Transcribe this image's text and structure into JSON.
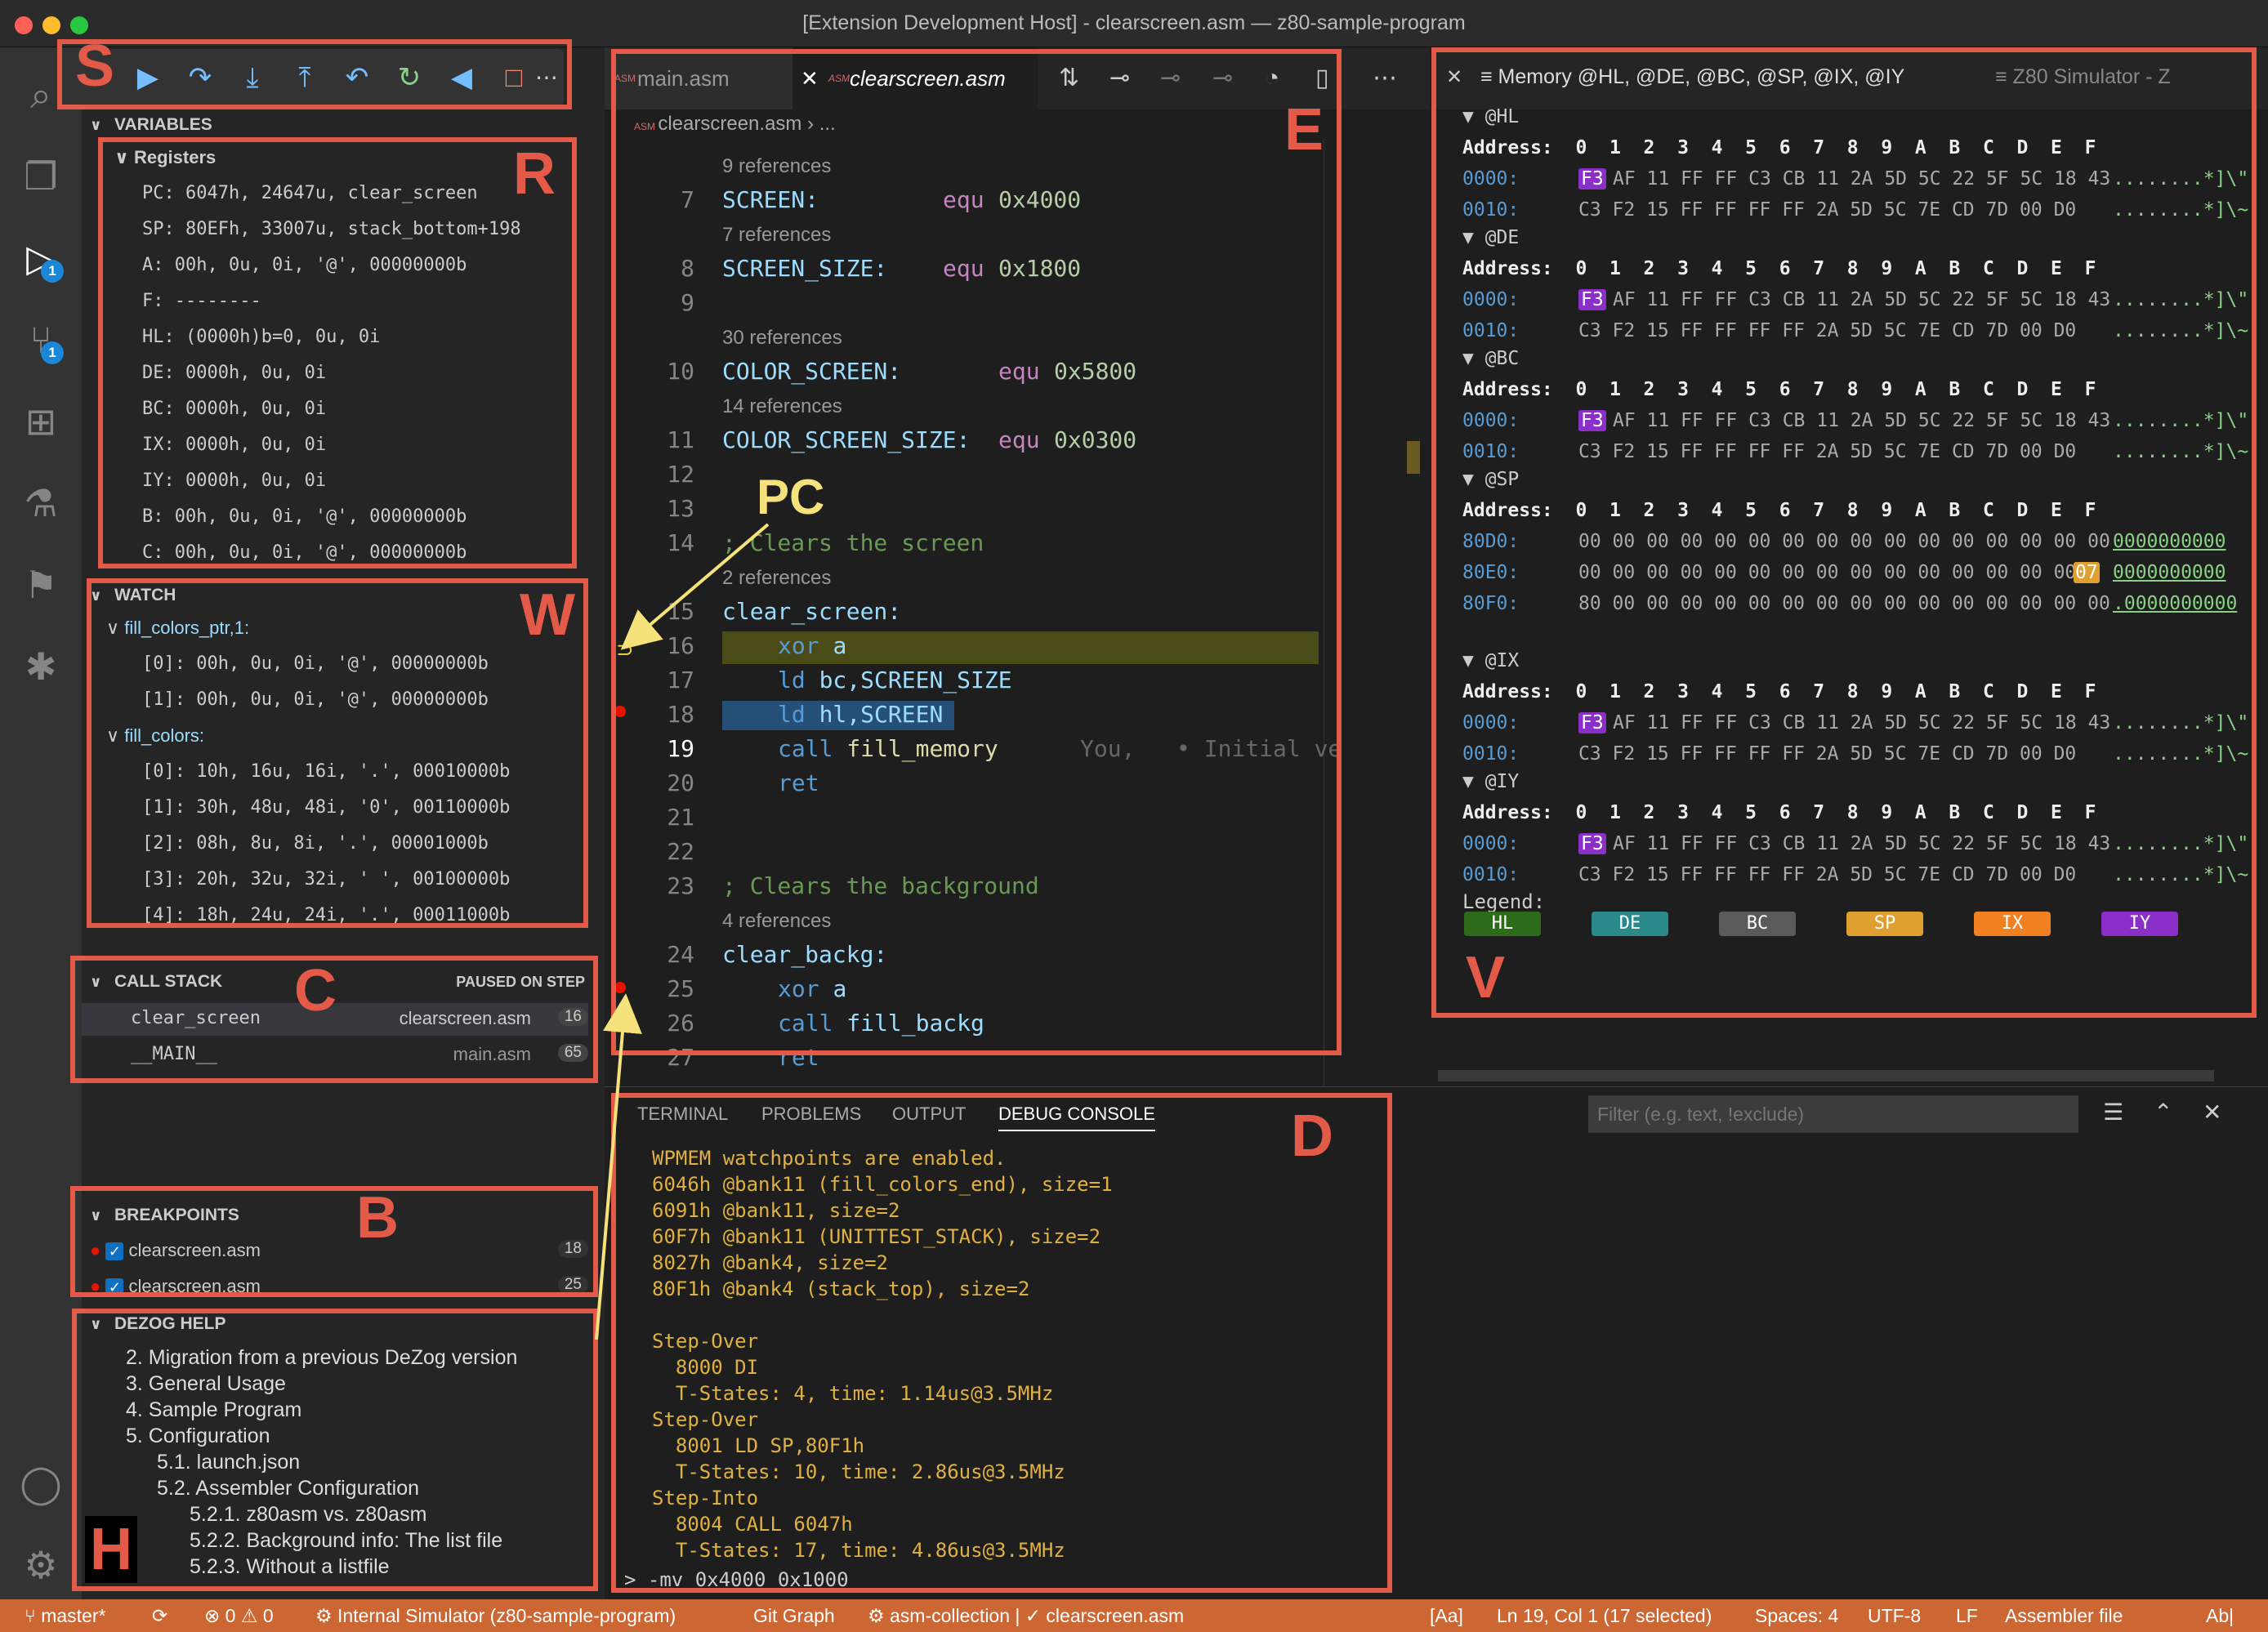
{
  "window": {
    "title": "[Extension Development Host] - clearscreen.asm — z80-sample-program"
  },
  "activity": {
    "debug_badge": "1",
    "scm_badge": "1"
  },
  "variables": {
    "header": "VARIABLES",
    "registers_label": "Registers",
    "rows": [
      "PC: 6047h, 24647u, clear_screen",
      "SP: 80EFh, 33007u, stack_bottom+198",
      "A: 00h, 0u, 0i, '@', 00000000b",
      "F: --------",
      "HL: (0000h)b=0, 0u, 0i",
      "DE: 0000h, 0u, 0i",
      "BC: 0000h, 0u, 0i",
      "IX: 0000h, 0u, 0i",
      "IY: 0000h, 0u, 0i",
      "B: 00h, 0u, 0i, '@', 00000000b",
      "C: 00h, 0u, 0i, '@', 00000000b"
    ]
  },
  "watch": {
    "header": "WATCH",
    "group1": "fill_colors_ptr,1:",
    "group1_rows": [
      "[0]: 00h,   0u,    0i, '@', 00000000b",
      "[1]: 00h,   0u,    0i, '@', 00000000b"
    ],
    "group2": "fill_colors:",
    "group2_rows": [
      "[0]: 10h,  16u,   16i, '.', 00010000b",
      "[1]: 30h,  48u,   48i, '0', 00110000b",
      "[2]: 08h,   8u,    8i, '.', 00001000b",
      "[3]: 20h,  32u,   32i, ' ', 00100000b",
      "[4]: 18h,  24u,   24i, '.', 00011000b"
    ]
  },
  "callstack": {
    "header": "CALL STACK",
    "status": "PAUSED ON STEP",
    "frames": [
      {
        "name": "clear_screen",
        "file": "clearscreen.asm",
        "line": "16"
      },
      {
        "name": "__MAIN__",
        "file": "main.asm",
        "line": "65"
      }
    ]
  },
  "breakpoints": {
    "header": "BREAKPOINTS",
    "items": [
      {
        "file": "clearscreen.asm",
        "line": "18"
      },
      {
        "file": "clearscreen.asm",
        "line": "25"
      }
    ]
  },
  "dezog_help": {
    "header": "DEZOG HELP",
    "items": [
      "2. Migration from a previous DeZog version",
      "3. General Usage",
      "4. Sample Program",
      "5. Configuration",
      "5.1. launch.json",
      "5.2. Assembler Configuration",
      "5.2.1. z80asm vs. z80asm",
      "5.2.2. Background info: The list file",
      "5.2.3. Without a listfile"
    ]
  },
  "editor": {
    "tabs": [
      {
        "label": "main.asm"
      },
      {
        "label": "clearscreen.asm"
      }
    ],
    "breadcrumb": "clearscreen.asm",
    "breadcrumb_more": "...",
    "refs": {
      "r7": "9 references",
      "r8": "7 references",
      "r10": "30 references",
      "r11": "14 references",
      "r15": "2 references",
      "r24": "4 references"
    },
    "gutter": [
      "7",
      "8",
      "9",
      "10",
      "11",
      "12",
      "13",
      "14",
      "15",
      "16",
      "17",
      "18",
      "19",
      "20",
      "21",
      "22",
      "23",
      "24",
      "25",
      "26",
      "27"
    ],
    "code": {
      "l7a": "SCREEN:",
      "l7b": "equ",
      "l7c": "0x4000",
      "l8a": "SCREEN_SIZE:",
      "l8b": "equ",
      "l8c": "0x1800",
      "l10a": "COLOR_SCREEN:",
      "l10b": "equ",
      "l10c": "0x5800",
      "l11a": "COLOR_SCREEN_SIZE:",
      "l11b": "equ",
      "l11c": "0x0300",
      "l14": "; Clears the screen",
      "l15": "clear_screen:",
      "l16a": "xor",
      "l16b": "a",
      "l17a": "ld",
      "l17b": "bc,SCREEN_SIZE",
      "l18a": "ld",
      "l18b": "hl,SCREEN",
      "l19a": "call",
      "l19b": "fill_memory",
      "l19blame": "You,   • Initial ve",
      "l20": "ret",
      "l23": "; Clears the background",
      "l24": "clear_backg:",
      "l25a": "xor",
      "l25b": "a",
      "l26a": "call",
      "l26b": "fill_backg",
      "l27": "ret"
    }
  },
  "memory": {
    "tab1": "Memory @HL, @DE, @BC, @SP, @IX, @IY",
    "tab2": "Z80 Simulator - Z",
    "header_row": "Address:  0  1  2  3  4  5  6  7  8  9  A  B  C  D  E  F",
    "groups": [
      {
        "name": "@HL",
        "r1": "AF 11 FF FF C3 CB 11 2A 5D 5C 22 5F 5C 18 43",
        "r1ascii": "........*]\\\"",
        "r2": "C3 F2 15 FF FF FF FF 2A 5D 5C 7E CD 7D 00 D0",
        "r2ascii": "........*]\\~"
      },
      {
        "name": "@DE",
        "r1": "AF 11 FF FF C3 CB 11 2A 5D 5C 22 5F 5C 18 43",
        "r1ascii": "........*]\\\"",
        "r2": "C3 F2 15 FF FF FF FF 2A 5D 5C 7E CD 7D 00 D0",
        "r2ascii": "........*]\\~"
      },
      {
        "name": "@BC",
        "r1": "AF 11 FF FF C3 CB 11 2A 5D 5C 22 5F 5C 18 43",
        "r1ascii": "........*]\\\"",
        "r2": "C3 F2 15 FF FF FF FF 2A 5D 5C 7E CD 7D 00 D0",
        "r2ascii": "........*]\\~"
      },
      {
        "name": "@IX",
        "r1": "AF 11 FF FF C3 CB 11 2A 5D 5C 22 5F 5C 18 43",
        "r1ascii": "........*]\\\"",
        "r2": "C3 F2 15 FF FF FF FF 2A 5D 5C 7E CD 7D 00 D0",
        "r2ascii": "........*]\\~"
      },
      {
        "name": "@IY",
        "r1": "AF 11 FF FF C3 CB 11 2A 5D 5C 22 5F 5C 18 43",
        "r1ascii": "........*]\\\"",
        "r2": "C3 F2 15 FF FF FF FF 2A 5D 5C 7E CD 7D 00 D0",
        "r2ascii": "........*]\\~"
      }
    ],
    "addr0": "0000:",
    "addr1": "0010:",
    "first_byte": "F3",
    "sp": {
      "name": "@SP",
      "a1": "80D0:",
      "d1": "00 00 00 00 00 00 00 00 00 00 00 00 00 00 00 00",
      "t1": "0000000000",
      "a2": "80E0:",
      "d2": "00 00 00 00 00 00 00 00 00 00 00 00 00 00 00",
      "hl2": "07",
      "t2": "0000000000",
      "a3": "80F0:",
      "d3": "80 00 00 00 00 00 00 00 00 00 00 00 00 00 00 00",
      "t3": ".0000000000"
    },
    "legend_label": "Legend:",
    "legend": [
      "HL",
      "DE",
      "BC",
      "SP",
      "IX",
      "IY"
    ]
  },
  "panel": {
    "tabs": [
      "TERMINAL",
      "PROBLEMS",
      "OUTPUT",
      "DEBUG CONSOLE"
    ],
    "filter_placeholder": "Filter (e.g. text, !exclude)",
    "console": [
      "WPMEM watchpoints are enabled.",
      "6046h @bank11 (fill_colors_end), size=1",
      "6091h @bank11, size=2",
      "60F7h @bank11 (UNITTEST_STACK), size=2",
      "8027h @bank4, size=2",
      "80F1h @bank4 (stack_top), size=2",
      "",
      "Step-Over",
      "  8000 DI",
      "  T-States: 4, time: 1.14us@3.5MHz",
      "Step-Over",
      "  8001 LD SP,80F1h",
      "  T-States: 10, time: 2.86us@3.5MHz",
      "Step-Into",
      "  8004 CALL 6047h",
      "  T-States: 17, time: 4.86us@3.5MHz"
    ],
    "input": "-mv 0x4000 0x1000"
  },
  "statusbar": {
    "branch": "master*",
    "errors": "0",
    "warnings": "0",
    "debug": "Internal Simulator (z80-sample-program)",
    "gitgraph": "Git Graph",
    "asm": "asm-collection | ✓ clearscreen.asm",
    "aa": "[Aa]",
    "pos": "Ln 19, Col 1 (17 selected)",
    "spaces": "Spaces: 4",
    "enc": "UTF-8",
    "eol": "LF",
    "lang": "Assembler file",
    "ab": "Ab|"
  },
  "annotations": {
    "S": "S",
    "R": "R",
    "W": "W",
    "C": "C",
    "B": "B",
    "H": "H",
    "E": "E",
    "V": "V",
    "D": "D",
    "PC": "PC"
  },
  "colors": {
    "annotation": "#e45a49",
    "statusbar": "#cc6633",
    "pc_label": "#f5e27a",
    "hl": "#2d6a1a",
    "de": "#2a8a8a",
    "bc": "#5a5a5a",
    "sp": "#e0a030",
    "ix": "#f08020",
    "iy": "#8b2fc9"
  }
}
